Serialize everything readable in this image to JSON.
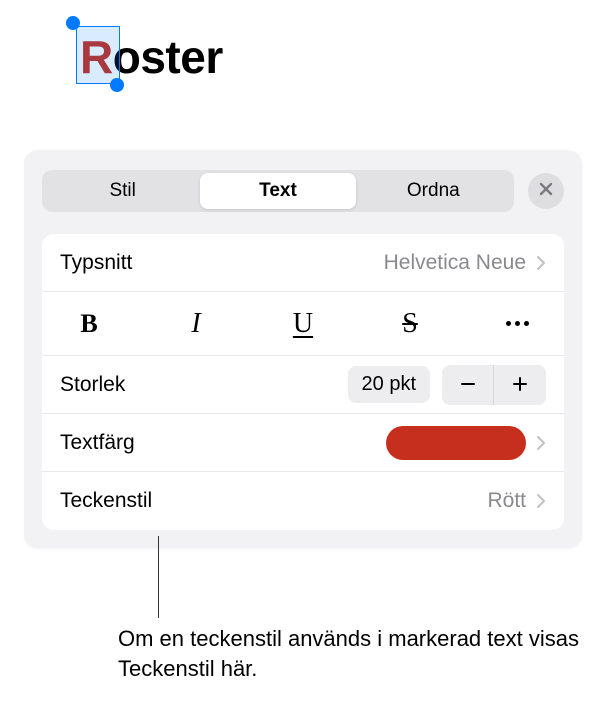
{
  "canvas": {
    "word_first_letter": "R",
    "word_rest": "oster"
  },
  "panel": {
    "tabs": {
      "style": "Stil",
      "text": "Text",
      "arrange": "Ordna"
    },
    "font_row": {
      "label": "Typsnitt",
      "value": "Helvetica Neue"
    },
    "style_buttons": {
      "bold": "B",
      "italic": "I",
      "underline": "U",
      "strike": "S"
    },
    "size_row": {
      "label": "Storlek",
      "value": "20 pkt"
    },
    "color_row": {
      "label": "Textfärg",
      "swatch_color": "#C62F1E"
    },
    "charstyle_row": {
      "label": "Teckenstil",
      "value": "Rött"
    }
  },
  "callout": "Om en teckenstil används i markerad text visas Teckenstil här."
}
